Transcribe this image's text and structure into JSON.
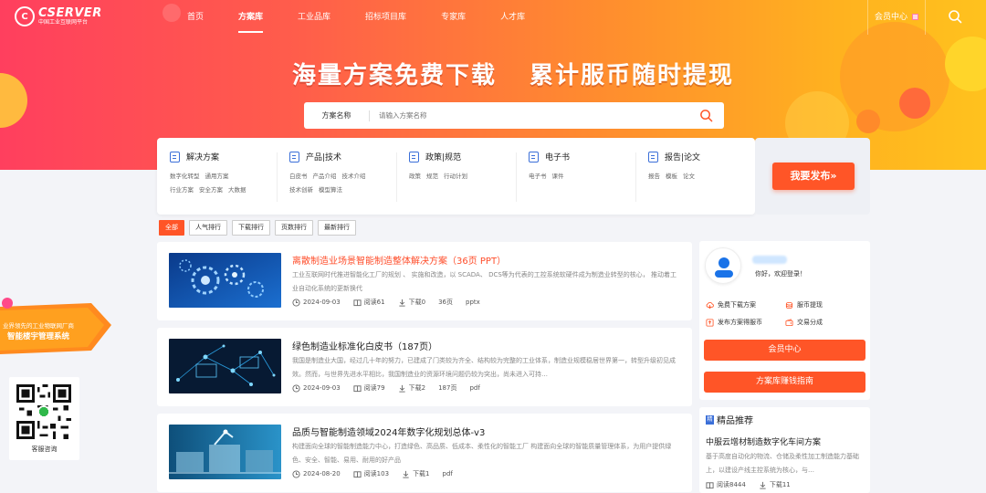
{
  "logo": {
    "brand": "CSERVER",
    "tagline": "中国工业互联网平台"
  },
  "nav": {
    "items": [
      "首页",
      "方案库",
      "工业品库",
      "招标项目库",
      "专家库",
      "人才库"
    ],
    "active_index": 1
  },
  "header": {
    "member_center": "会员中心"
  },
  "hero": {
    "slogan_left": "海量方案免费下载",
    "slogan_right": "累计服币随时提现"
  },
  "search": {
    "label": "方案名称",
    "placeholder": "请输入方案名称"
  },
  "categories": [
    {
      "title": "解决方案",
      "links": [
        "数字化转型",
        "通用方案",
        "行业方案",
        "安全方案",
        "大数据"
      ]
    },
    {
      "title": "产品|技术",
      "links": [
        "白皮书",
        "产品介绍",
        "技术介绍",
        "技术创新",
        "模型算法"
      ]
    },
    {
      "title": "政策|规范",
      "links": [
        "政策",
        "规范",
        "行动计划"
      ]
    },
    {
      "title": "电子书",
      "links": [
        "电子书",
        "课件"
      ]
    },
    {
      "title": "报告|论文",
      "links": [
        "报告",
        "模板",
        "论文"
      ]
    }
  ],
  "publish_button": "我要发布»",
  "tabs": [
    "全部",
    "人气排行",
    "下载排行",
    "页数排行",
    "最新排行"
  ],
  "active_tab": 0,
  "cards": [
    {
      "title": "离散制造业场景智能制造整体解决方案（36页 PPT）",
      "highlight": true,
      "desc": "工业互联网时代推进智能化工厂的规划 、 实施和改造，以 SCADA、 DCS等为代表的工控系统软硬件成为制造业转型的核心， 推动着工业自动化系统的更新换代",
      "date": "2024-09-03",
      "views": "阅读61",
      "downloads": "下载0",
      "pages": "36页",
      "format": "pptx"
    },
    {
      "title": "绿色制造业标准化白皮书（187页）",
      "highlight": false,
      "desc": "我国是制造业大国，经过几十年的努力，已建成了门类较为齐全、结构较为完整的工业体系，制造业规模稳居世界第一，转型升级初见成效。然而，与世界先进水平相比，我国制造业的资源环境问题仍较为突出，尚未进入可持…",
      "date": "2024-09-03",
      "views": "阅读79",
      "downloads": "下载2",
      "pages": "187页",
      "format": "pdf"
    },
    {
      "title": "品质与智能制造领域2024年数字化规划总体-v3",
      "highlight": false,
      "desc": "构建面向全球的智能制造能力中心，打造绿色、高品质、低成本、柔性化的智能工厂 构建面向全球的智能质量管理体系，为用户提供绿色、安全、智能、易用、耐用的好产品",
      "date": "2024-08-20",
      "views": "阅读103",
      "downloads": "下载1",
      "pages": "",
      "format": "pdf"
    }
  ],
  "sidebar": {
    "greeting": "你好，欢迎登录！",
    "features": [
      "免费下载方案",
      "服币提现",
      "发布方案得服币",
      "交易分成"
    ],
    "member_button": "会员中心",
    "guide_button": "方案库赚钱指南"
  },
  "recommend": {
    "badge": "精",
    "heading": "精品推荐",
    "title": "中服云增材制造数字化车间方案",
    "desc": "基于高度自动化的物流、仓储及柔性加工制造能力基础上，以建设产线主控系统为核心，与…",
    "views": "阅读8444",
    "downloads": "下载11"
  },
  "left_banner": {
    "line1": "业界领先的工业物联网厂商",
    "line2": "智能楼宇管理系统"
  },
  "qr": {
    "label": "客服咨询"
  },
  "colors": {
    "accent": "#ff5527",
    "link_blue": "#3b6fd8"
  }
}
